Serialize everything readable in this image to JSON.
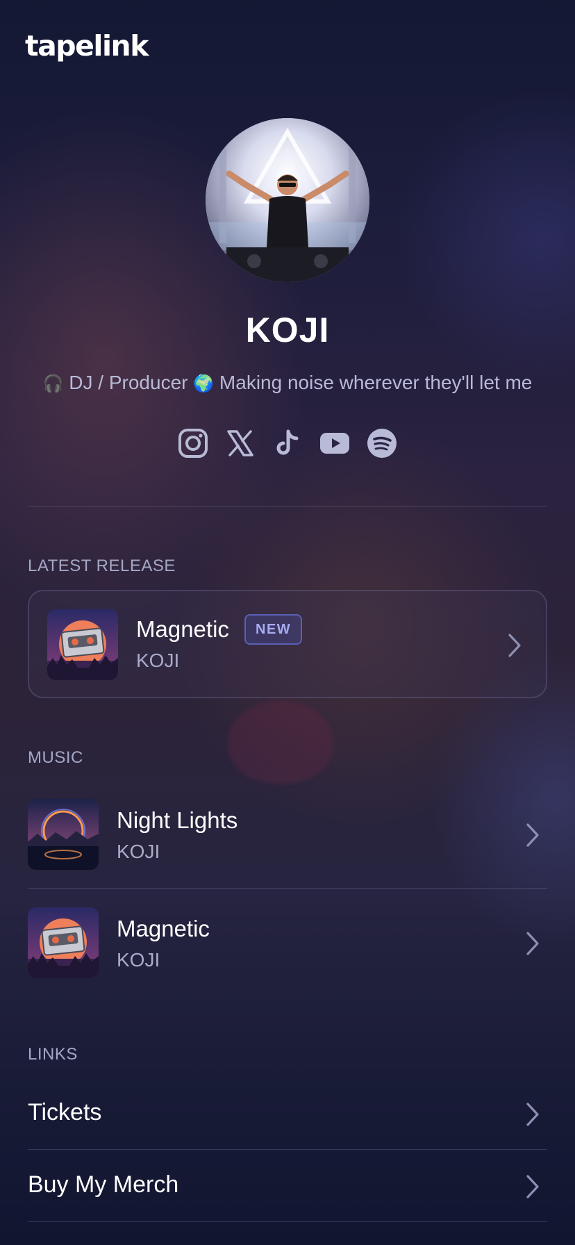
{
  "brand": {
    "logo_text": "tapelink"
  },
  "profile": {
    "name": "KOJI",
    "bio_emoji_1": "🎧",
    "bio_text_1": "DJ / Producer",
    "bio_emoji_2": "🌍",
    "bio_text_2": "Making noise wherever they'll let me",
    "avatar_icon": "dj-photo"
  },
  "socials": [
    {
      "name": "instagram",
      "icon": "instagram-icon"
    },
    {
      "name": "x",
      "icon": "x-icon"
    },
    {
      "name": "tiktok",
      "icon": "tiktok-icon"
    },
    {
      "name": "youtube",
      "icon": "youtube-icon"
    },
    {
      "name": "spotify",
      "icon": "spotify-icon"
    }
  ],
  "latest_release": {
    "label": "LATEST RELEASE",
    "title": "Magnetic",
    "badge": "NEW",
    "artist": "KOJI"
  },
  "music": {
    "label": "MUSIC",
    "items": [
      {
        "title": "Night Lights",
        "artist": "KOJI"
      },
      {
        "title": "Magnetic",
        "artist": "KOJI"
      }
    ]
  },
  "links": {
    "label": "LINKS",
    "items": [
      {
        "label": "Tickets"
      },
      {
        "label": "Buy My Merch"
      }
    ]
  },
  "colors": {
    "background": "#151a34",
    "text_primary": "#ffffff",
    "text_secondary": "#a9abc9",
    "badge_border": "#5a60b6",
    "badge_text": "#a7acef"
  }
}
